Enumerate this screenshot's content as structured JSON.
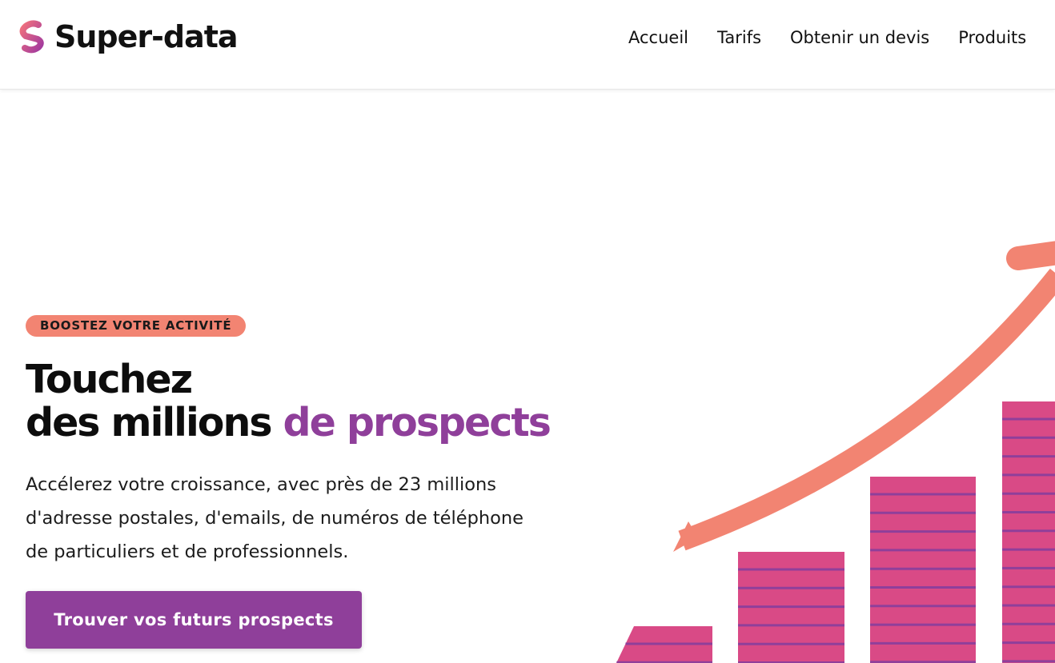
{
  "header": {
    "brand": "Super-data",
    "logo_icon": "super-data-s-logo-icon",
    "nav": [
      {
        "label": "Accueil"
      },
      {
        "label": "Tarifs"
      },
      {
        "label": "Obtenir un devis"
      },
      {
        "label": "Produits"
      }
    ]
  },
  "hero": {
    "badge": "BOOSTEZ VOTRE ACTIVITÉ",
    "title_line1": "Touchez",
    "title_line2_plain": "des millions ",
    "title_line2_highlight": "de prospects",
    "lead_line1": "Accélerez votre croissance, avec près de 23 millions",
    "lead_line2": "d'adresse postales, d'emails, de numéros de téléphone",
    "lead_line3": "de particuliers et de professionnels.",
    "cta_label": "Trouver vos futurs prospects"
  },
  "illustration": {
    "name": "growth-bar-chart-illustration",
    "bar_color": "#d94a86",
    "stripe_color": "#8f3f9a",
    "arrow_color": "#f28472"
  },
  "colors": {
    "accent": "#8f3f9a",
    "badge": "#f28472",
    "pink": "#d94a86"
  }
}
